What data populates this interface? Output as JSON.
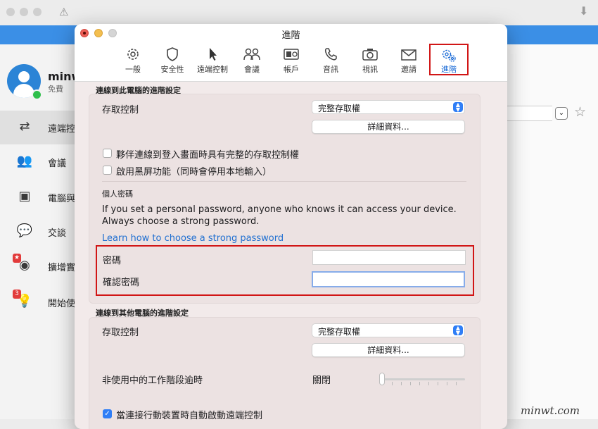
{
  "background_app": {
    "user_name": "minw",
    "plan": "免費",
    "nav": [
      {
        "label": "遠端控",
        "icon": "arrows-swap-icon",
        "active": true
      },
      {
        "label": "會議",
        "icon": "people-icon"
      },
      {
        "label": "電腦與",
        "icon": "contact-book-icon"
      },
      {
        "label": "交談",
        "icon": "chat-bubbles-icon"
      },
      {
        "label": "擴增實",
        "icon": "ar-glasses-icon",
        "badge": "★"
      },
      {
        "label": "開始使",
        "icon": "lightbulb-icon",
        "badge": "3"
      }
    ],
    "warning_icon": "warning-icon",
    "download_icon": "download-icon",
    "star_icon": "star-icon",
    "accent_color": "#3b8fe6"
  },
  "dialog": {
    "title": "進階",
    "tabs": [
      {
        "label": "一般",
        "icon": "gear-icon"
      },
      {
        "label": "安全性",
        "icon": "shield-icon"
      },
      {
        "label": "遠端控制",
        "icon": "cursor-icon"
      },
      {
        "label": "會議",
        "icon": "people-icon"
      },
      {
        "label": "帳戶",
        "icon": "id-card-icon"
      },
      {
        "label": "音訊",
        "icon": "phone-icon"
      },
      {
        "label": "視訊",
        "icon": "camera-icon"
      },
      {
        "label": "邀請",
        "icon": "envelope-icon"
      },
      {
        "label": "進階",
        "icon": "gears-icon",
        "selected": true
      }
    ],
    "section1": {
      "title": "連線到此電腦的進階設定",
      "access_control_label": "存取控制",
      "access_control_value": "完整存取權",
      "details_button": "詳細資料...",
      "checkbox1": "夥伴連線到登入畫面時具有完整的存取控制權",
      "checkbox2": "啟用黑屏功能（同時會停用本地輸入）",
      "personal_password_title": "個人密碼",
      "personal_password_desc": "If you set a personal password, anyone who knows it can access your device. Always choose a strong password.",
      "learn_link": "Learn how to choose a strong password",
      "password_label": "密碼",
      "confirm_password_label": "確認密碼",
      "password_value": "",
      "confirm_password_value": ""
    },
    "section2": {
      "title": "連線到其他電腦的進階設定",
      "access_control_label": "存取控制",
      "access_control_value": "完整存取權",
      "details_button": "詳細資料...",
      "idle_label": "非使用中的工作階段逾時",
      "idle_value": "關閉",
      "idle_slider_level": 0,
      "mobile_checkbox": "當連接行動裝置時自動啟動遠端控制",
      "mobile_checked": true
    }
  },
  "watermark": "minwt.com"
}
